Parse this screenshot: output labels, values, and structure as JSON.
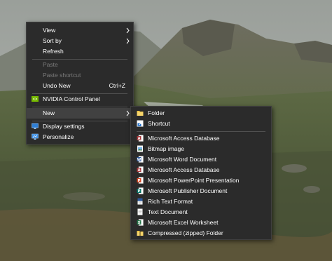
{
  "context_menu": {
    "view_label": "View",
    "sort_by_label": "Sort by",
    "refresh_label": "Refresh",
    "paste_label": "Paste",
    "paste_shortcut_label": "Paste shortcut",
    "undo_new_label": "Undo New",
    "undo_new_shortcut": "Ctrl+Z",
    "nvidia_label": "NVIDIA Control Panel",
    "new_label": "New",
    "display_settings_label": "Display settings",
    "personalize_label": "Personalize"
  },
  "new_submenu": {
    "items": [
      {
        "label": "Folder",
        "icon": "folder-icon"
      },
      {
        "label": "Shortcut",
        "icon": "shortcut-icon"
      },
      {
        "label": "Microsoft Access Database",
        "icon": "access-icon"
      },
      {
        "label": "Bitmap image",
        "icon": "bitmap-icon"
      },
      {
        "label": "Microsoft Word Document",
        "icon": "word-icon"
      },
      {
        "label": "Microsoft Access Database",
        "icon": "access-icon"
      },
      {
        "label": "Microsoft PowerPoint Presentation",
        "icon": "powerpoint-icon"
      },
      {
        "label": "Microsoft Publisher Document",
        "icon": "publisher-icon"
      },
      {
        "label": "Rich Text Format",
        "icon": "rtf-icon"
      },
      {
        "label": "Text Document",
        "icon": "text-document-icon"
      },
      {
        "label": "Microsoft Excel Worksheet",
        "icon": "excel-icon"
      },
      {
        "label": "Compressed (zipped) Folder",
        "icon": "zip-folder-icon"
      }
    ]
  },
  "colors": {
    "menu_background": "#2b2b2b",
    "menu_text": "#ffffff",
    "disabled_text": "#7a7a7a",
    "highlight": "#414141"
  }
}
